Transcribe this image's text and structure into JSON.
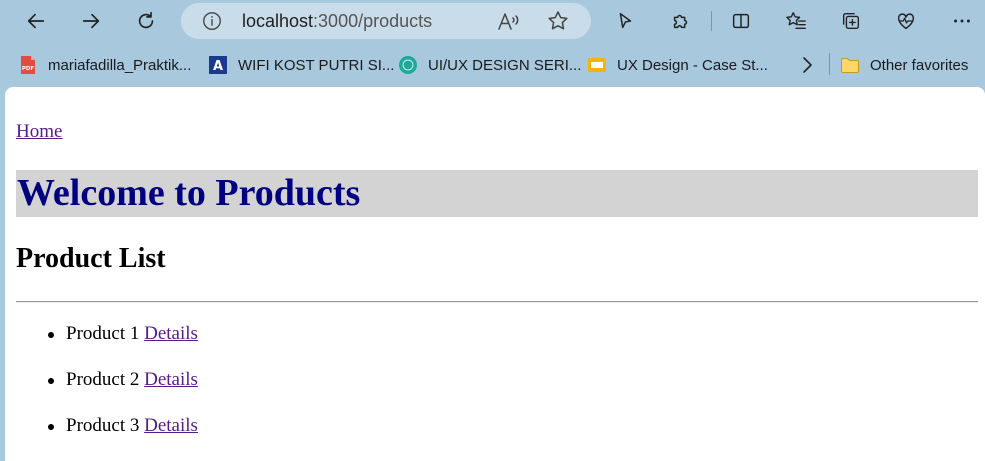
{
  "browser": {
    "url_host": "localhost",
    "url_path": ":3000/products",
    "icons": {
      "back": "back-arrow-icon",
      "forward": "forward-arrow-icon",
      "refresh": "refresh-icon",
      "site_info": "info-icon",
      "read_aloud": "read-aloud-icon",
      "favorite": "star-icon",
      "copilot": "cursor-icon",
      "extensions": "puzzle-icon",
      "split_screen": "split-screen-icon",
      "favorites": "favorites-list-icon",
      "collections": "collections-icon",
      "browser_essentials": "heartbeat-icon",
      "menu": "more-icon"
    }
  },
  "bookmarks": [
    {
      "label": "mariafadilla_Praktik...",
      "icon": "pdf-icon"
    },
    {
      "label": "WIFI KOST PUTRI SI...",
      "icon": "letter-a-icon"
    },
    {
      "label": "UI/UX DESIGN SERI...",
      "icon": "mysk-icon"
    },
    {
      "label": "UX Design - Case St...",
      "icon": "slides-icon"
    }
  ],
  "other_favorites": "Other favorites",
  "page": {
    "home_link": "Home",
    "banner_title": "Welcome to Products",
    "list_title": "Product List",
    "products": [
      {
        "name": "Product 1",
        "link": "Details"
      },
      {
        "name": "Product 2",
        "link": "Details"
      },
      {
        "name": "Product 3",
        "link": "Details"
      }
    ]
  },
  "colors": {
    "chrome": "#a8c8de",
    "address_bar": "#c9dce9",
    "banner_bg": "#d3d3d3",
    "banner_text": "#000080",
    "link": "#551a8b"
  }
}
